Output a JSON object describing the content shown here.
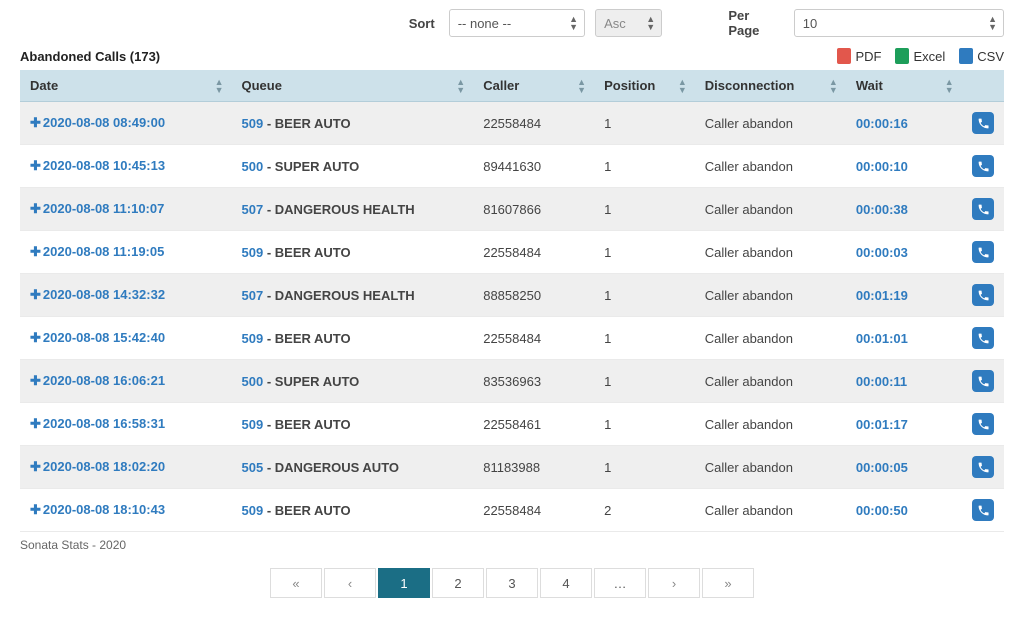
{
  "controls": {
    "sort_label": "Sort",
    "sort_value": "-- none --",
    "dir_value": "Asc",
    "perpage_label": "Per Page",
    "perpage_value": "10"
  },
  "title": "Abandoned Calls (173)",
  "exports": {
    "pdf": {
      "label": "PDF"
    },
    "excel": {
      "label": "Excel"
    },
    "csv": {
      "label": "CSV"
    }
  },
  "columns": {
    "date": "Date",
    "queue": "Queue",
    "caller": "Caller",
    "position": "Position",
    "disconnection": "Disconnection",
    "wait": "Wait"
  },
  "rows": [
    {
      "date": "2020-08-08 08:49:00",
      "queue_code": "509",
      "queue_name": "BEER AUTO",
      "caller": "22558484",
      "position": "1",
      "disc": "Caller abandon",
      "wait": "00:00:16"
    },
    {
      "date": "2020-08-08 10:45:13",
      "queue_code": "500",
      "queue_name": "SUPER AUTO",
      "caller": "89441630",
      "position": "1",
      "disc": "Caller abandon",
      "wait": "00:00:10"
    },
    {
      "date": "2020-08-08 11:10:07",
      "queue_code": "507",
      "queue_name": "DANGEROUS HEALTH",
      "caller": "81607866",
      "position": "1",
      "disc": "Caller abandon",
      "wait": "00:00:38"
    },
    {
      "date": "2020-08-08 11:19:05",
      "queue_code": "509",
      "queue_name": "BEER AUTO",
      "caller": "22558484",
      "position": "1",
      "disc": "Caller abandon",
      "wait": "00:00:03"
    },
    {
      "date": "2020-08-08 14:32:32",
      "queue_code": "507",
      "queue_name": "DANGEROUS HEALTH",
      "caller": "88858250",
      "position": "1",
      "disc": "Caller abandon",
      "wait": "00:01:19"
    },
    {
      "date": "2020-08-08 15:42:40",
      "queue_code": "509",
      "queue_name": "BEER AUTO",
      "caller": "22558484",
      "position": "1",
      "disc": "Caller abandon",
      "wait": "00:01:01"
    },
    {
      "date": "2020-08-08 16:06:21",
      "queue_code": "500",
      "queue_name": "SUPER AUTO",
      "caller": "83536963",
      "position": "1",
      "disc": "Caller abandon",
      "wait": "00:00:11"
    },
    {
      "date": "2020-08-08 16:58:31",
      "queue_code": "509",
      "queue_name": "BEER AUTO",
      "caller": "22558461",
      "position": "1",
      "disc": "Caller abandon",
      "wait": "00:01:17"
    },
    {
      "date": "2020-08-08 18:02:20",
      "queue_code": "505",
      "queue_name": "DANGEROUS AUTO",
      "caller": "81183988",
      "position": "1",
      "disc": "Caller abandon",
      "wait": "00:00:05"
    },
    {
      "date": "2020-08-08 18:10:43",
      "queue_code": "509",
      "queue_name": "BEER AUTO",
      "caller": "22558484",
      "position": "2",
      "disc": "Caller abandon",
      "wait": "00:00:50"
    }
  ],
  "footer": "Sonata Stats - 2020",
  "pagination": {
    "first": "«",
    "prev": "‹",
    "pages": [
      "1",
      "2",
      "3",
      "4",
      "…"
    ],
    "active": "1",
    "next": "›",
    "last": "»"
  }
}
